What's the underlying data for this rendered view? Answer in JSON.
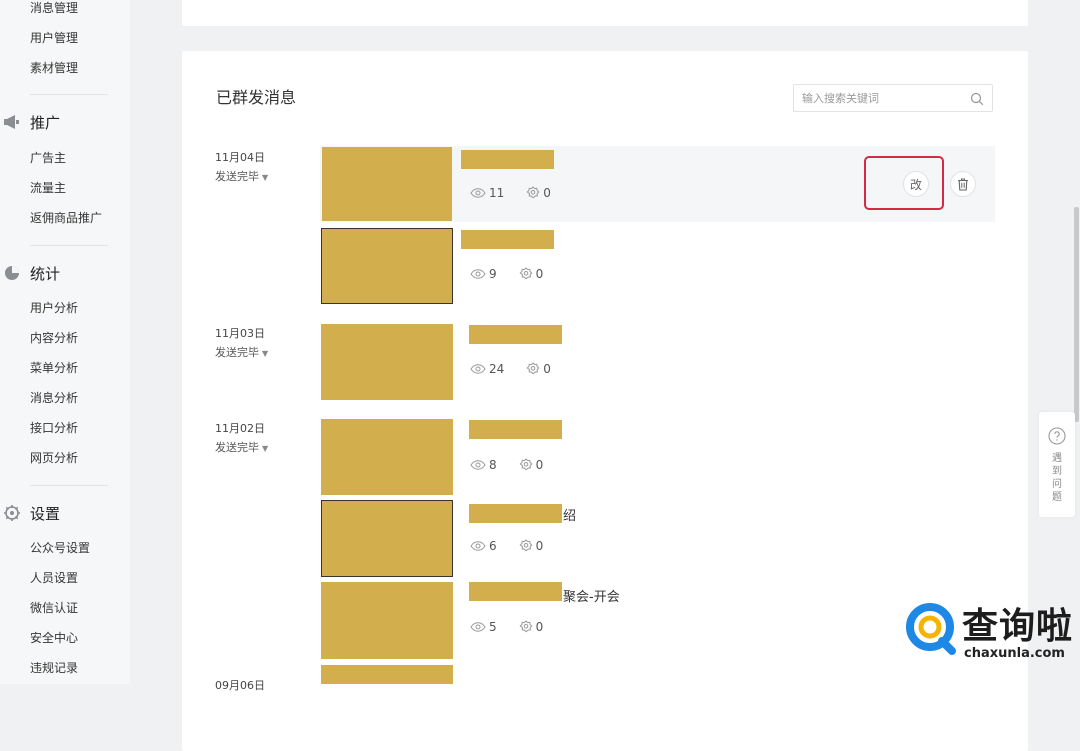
{
  "sidebar": {
    "top_items": [
      "消息管理",
      "用户管理",
      "素材管理"
    ],
    "groups": [
      {
        "title": "推广",
        "icon": "megaphone-icon",
        "items": [
          "广告主",
          "流量主",
          "返佣商品推广"
        ]
      },
      {
        "title": "统计",
        "icon": "pie-chart-icon",
        "items": [
          "用户分析",
          "内容分析",
          "菜单分析",
          "消息分析",
          "接口分析",
          "网页分析"
        ]
      },
      {
        "title": "设置",
        "icon": "gear-icon",
        "items": [
          "公众号设置",
          "人员设置",
          "微信认证",
          "安全中心",
          "违规记录"
        ]
      }
    ]
  },
  "main": {
    "title": "已群发消息",
    "search": {
      "placeholder": "输入搜索关键词",
      "value": ""
    },
    "groups": [
      {
        "date": "11月04日",
        "status": "发送完毕",
        "messages": [
          {
            "title_visible": "",
            "views": "11",
            "likes": "0",
            "highlighted": true,
            "edit_label": "改"
          },
          {
            "title_visible": "",
            "views": "9",
            "likes": "0"
          }
        ]
      },
      {
        "date": "11月03日",
        "status": "发送完毕",
        "messages": [
          {
            "title_visible": "",
            "views": "24",
            "likes": "0"
          }
        ]
      },
      {
        "date": "11月02日",
        "status": "发送完毕",
        "messages": [
          {
            "title_visible": "",
            "views": "8",
            "likes": "0"
          },
          {
            "title_visible": "绍",
            "views": "6",
            "likes": "0"
          },
          {
            "title_visible": "聚会-开会",
            "views": "5",
            "likes": "0"
          }
        ]
      },
      {
        "date": "09月06日",
        "status": "",
        "messages": []
      }
    ]
  },
  "help": {
    "text": "遇到问题"
  },
  "watermark": {
    "cn": "查询啦",
    "en": "chaxunla.com"
  },
  "colors": {
    "redacted": "#d3ae4d",
    "highlight_border": "#d42a45",
    "watermark_blue": "#1e88e5"
  }
}
